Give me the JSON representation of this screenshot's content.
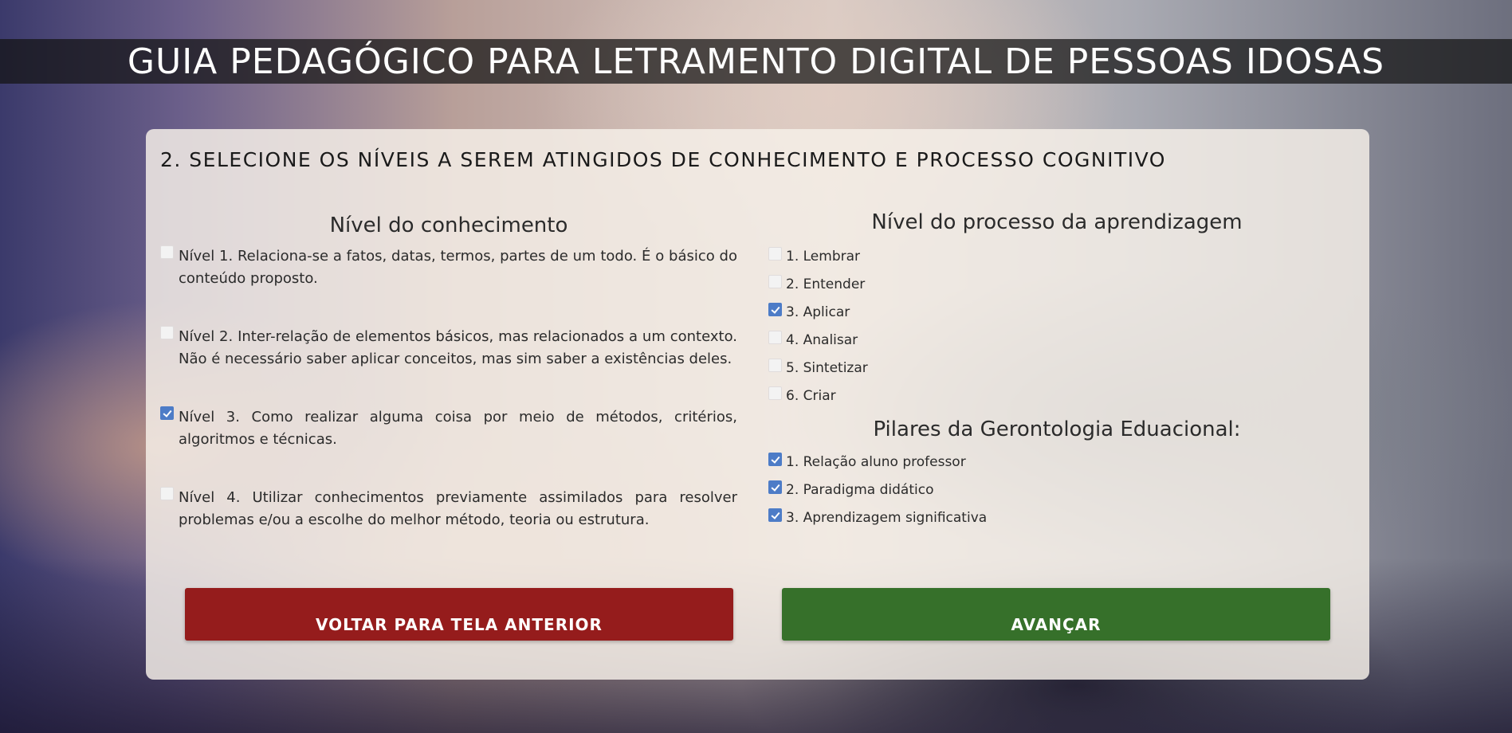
{
  "header": {
    "title": "GUIA PEDAGÓGICO PARA LETRAMENTO DIGITAL DE PESSOAS IDOSAS"
  },
  "panel": {
    "heading": "2. SELECIONE OS NÍVEIS A SEREM ATINGIDOS DE CONHECIMENTO E PROCESSO COGNITIVO"
  },
  "knowledge": {
    "title": "Nível do conhecimento",
    "items": [
      {
        "label": "Nível 1. Relaciona-se a fatos, datas, termos, partes de um todo. É o básico do conteúdo proposto.",
        "checked": false
      },
      {
        "label": "Nível 2. Inter-relação de elementos básicos, mas relacionados a um contexto. Não é necessário saber aplicar conceitos, mas sim saber a existências deles.",
        "checked": false
      },
      {
        "label": "Nível 3. Como realizar alguma coisa por meio de métodos, critérios, algoritmos e técnicas.",
        "checked": true
      },
      {
        "label": "Nível 4. Utilizar conhecimentos previamente assimilados para resolver problemas e/ou a escolhe do melhor método, teoria ou estrutura.",
        "checked": false
      }
    ]
  },
  "process": {
    "title": "Nível do processo da aprendizagem",
    "items": [
      {
        "label": "1. Lembrar",
        "checked": false
      },
      {
        "label": "2. Entender",
        "checked": false
      },
      {
        "label": "3. Aplicar",
        "checked": true
      },
      {
        "label": "4. Analisar",
        "checked": false
      },
      {
        "label": "5. Sintetizar",
        "checked": false
      },
      {
        "label": "6. Criar",
        "checked": false
      }
    ]
  },
  "pillars": {
    "title": "Pilares da Gerontologia Eduacional:",
    "items": [
      {
        "label": "1. Relação aluno professor",
        "checked": true
      },
      {
        "label": "2. Paradigma didático",
        "checked": true
      },
      {
        "label": "3. Aprendizagem significativa",
        "checked": true
      }
    ]
  },
  "buttons": {
    "back_label": "VOLTAR PARA TELA ANTERIOR",
    "next_label": "AVANÇAR"
  },
  "colors": {
    "back_button": "#951c1c",
    "next_button": "#36702a",
    "checkbox_checked": "#4d7cc7"
  }
}
